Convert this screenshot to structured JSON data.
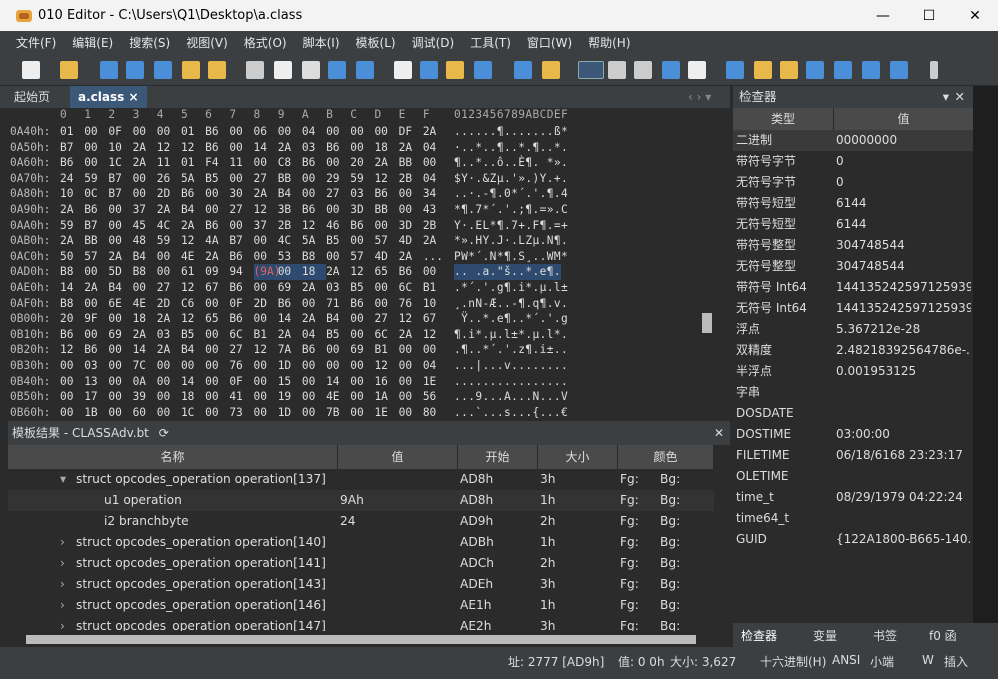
{
  "window": {
    "title": "010 Editor - C:\\Users\\Q1\\Desktop\\a.class",
    "min": "—",
    "max": "☐",
    "close": "✕"
  },
  "menu": [
    "文件(F)",
    "编辑(E)",
    "搜索(S)",
    "视图(V)",
    "格式(O)",
    "脚本(I)",
    "模板(L)",
    "调试(D)",
    "工具(T)",
    "窗口(W)",
    "帮助(H)"
  ],
  "tabs": {
    "start": "起始页",
    "file": "a.class ×"
  },
  "hex": {
    "header_cols": [
      "0",
      "1",
      "2",
      "3",
      "4",
      "5",
      "6",
      "7",
      "8",
      "9",
      "A",
      "B",
      "C",
      "D",
      "E",
      "F"
    ],
    "ascii_header": "0123456789ABCDEF",
    "rows": [
      {
        "addr": "0A40h:",
        "bytes": [
          "01",
          "00",
          "0F",
          "00",
          "00",
          "01",
          "B6",
          "00",
          "06",
          "00",
          "04",
          "00",
          "00",
          "00",
          "DF",
          "2A"
        ],
        "ascii": "......¶.......ß*"
      },
      {
        "addr": "0A50h:",
        "bytes": [
          "B7",
          "00",
          "10",
          "2A",
          "12",
          "12",
          "B6",
          "00",
          "14",
          "2A",
          "03",
          "B6",
          "00",
          "18",
          "2A",
          "04"
        ],
        "ascii": "·..*..¶..*.¶..*."
      },
      {
        "addr": "0A60h:",
        "bytes": [
          "B6",
          "00",
          "1C",
          "2A",
          "11",
          "01",
          "F4",
          "11",
          "00",
          "C8",
          "B6",
          "00",
          "20",
          "2A",
          "BB",
          "00"
        ],
        "ascii": "¶..*..ô..È¶. *»."
      },
      {
        "addr": "0A70h:",
        "bytes": [
          "24",
          "59",
          "B7",
          "00",
          "26",
          "5A",
          "B5",
          "00",
          "27",
          "BB",
          "00",
          "29",
          "59",
          "12",
          "2B",
          "04"
        ],
        "ascii": "$Y·.&Zµ.'».)Y.+."
      },
      {
        "addr": "0A80h:",
        "bytes": [
          "10",
          "0C",
          "B7",
          "00",
          "2D",
          "B6",
          "00",
          "30",
          "2A",
          "B4",
          "00",
          "27",
          "03",
          "B6",
          "00",
          "34"
        ],
        "ascii": "..·.-¶.0*´.'.¶.4"
      },
      {
        "addr": "0A90h:",
        "bytes": [
          "2A",
          "B6",
          "00",
          "37",
          "2A",
          "B4",
          "00",
          "27",
          "12",
          "3B",
          "B6",
          "00",
          "3D",
          "BB",
          "00",
          "43"
        ],
        "ascii": "*¶.7*´.'.;¶.=».C"
      },
      {
        "addr": "0AA0h:",
        "bytes": [
          "59",
          "B7",
          "00",
          "45",
          "4C",
          "2A",
          "B6",
          "00",
          "37",
          "2B",
          "12",
          "46",
          "B6",
          "00",
          "3D",
          "2B"
        ],
        "ascii": "Y·.EL*¶.7+.F¶.=+"
      },
      {
        "addr": "0AB0h:",
        "bytes": [
          "2A",
          "BB",
          "00",
          "48",
          "59",
          "12",
          "4A",
          "B7",
          "00",
          "4C",
          "5A",
          "B5",
          "00",
          "57",
          "4D",
          "2A"
        ],
        "ascii": "*».HY.J·.LZµ.N¶."
      },
      {
        "addr": "0AC0h:",
        "bytes": [
          "50",
          "57",
          "2A",
          "B4",
          "00",
          "4E",
          "2A",
          "B6",
          "00",
          "53",
          "B8",
          "00",
          "57",
          "4D",
          "2A",
          "..."
        ],
        "ascii": "PW*´.N*¶.S¸..WM*"
      },
      {
        "addr": "0AD0h:",
        "bytes": [
          "B8",
          "00",
          "5D",
          "B8",
          "00",
          "61",
          "09",
          "94",
          "(9A)",
          "00",
          "18",
          "2A",
          "12",
          "65",
          "B6",
          "00"
        ],
        "ascii": ".. .a.\"š..*.e¶."
      },
      {
        "addr": "0AE0h:",
        "bytes": [
          "14",
          "2A",
          "B4",
          "00",
          "27",
          "12",
          "67",
          "B6",
          "00",
          "69",
          "2A",
          "03",
          "B5",
          "00",
          "6C",
          "B1"
        ],
        "ascii": ".*´.'.g¶.i*.µ.l±"
      },
      {
        "addr": "0AF0h:",
        "bytes": [
          "B8",
          "00",
          "6E",
          "4E",
          "2D",
          "C6",
          "00",
          "0F",
          "2D",
          "B6",
          "00",
          "71",
          "B6",
          "00",
          "76",
          "10"
        ],
        "ascii": "¸.nN-Æ..-¶.q¶.v."
      },
      {
        "addr": "0B00h:",
        "bytes": [
          "20",
          "9F",
          "00",
          "18",
          "2A",
          "12",
          "65",
          "B6",
          "00",
          "14",
          "2A",
          "B4",
          "00",
          "27",
          "12",
          "67"
        ],
        "ascii": " Ÿ..*.e¶..*´.'.g"
      },
      {
        "addr": "0B10h:",
        "bytes": [
          "B6",
          "00",
          "69",
          "2A",
          "03",
          "B5",
          "00",
          "6C",
          "B1",
          "2A",
          "04",
          "B5",
          "00",
          "6C",
          "2A",
          "12"
        ],
        "ascii": "¶.i*.µ.l±*.µ.l*."
      },
      {
        "addr": "0B20h:",
        "bytes": [
          "12",
          "B6",
          "00",
          "14",
          "2A",
          "B4",
          "00",
          "27",
          "12",
          "7A",
          "B6",
          "00",
          "69",
          "B1",
          "00",
          "00"
        ],
        "ascii": ".¶..*´.'.z¶.i±.."
      },
      {
        "addr": "0B30h:",
        "bytes": [
          "00",
          "03",
          "00",
          "7C",
          "00",
          "00",
          "00",
          "76",
          "00",
          "1D",
          "00",
          "00",
          "00",
          "12",
          "00",
          "04"
        ],
        "ascii": "...|...v........"
      },
      {
        "addr": "0B40h:",
        "bytes": [
          "00",
          "13",
          "00",
          "0A",
          "00",
          "14",
          "00",
          "0F",
          "00",
          "15",
          "00",
          "14",
          "00",
          "16",
          "00",
          "1E"
        ],
        "ascii": "................"
      },
      {
        "addr": "0B50h:",
        "bytes": [
          "00",
          "17",
          "00",
          "39",
          "00",
          "18",
          "00",
          "41",
          "00",
          "19",
          "00",
          "4E",
          "00",
          "1A",
          "00",
          "56"
        ],
        "ascii": "...9...A...N...V"
      },
      {
        "addr": "0B60h:",
        "bytes": [
          "00",
          "1B",
          "00",
          "60",
          "00",
          "1C",
          "00",
          "73",
          "00",
          "1D",
          "00",
          "7B",
          "00",
          "1E",
          "00",
          "80"
        ],
        "ascii": "...`...s...{...€"
      },
      {
        "addr": "0B70h:",
        "bytes": [
          "00",
          "1F",
          "00",
          "84",
          "00",
          "20",
          "00",
          "8C",
          "00",
          "22",
          "00",
          "92",
          "00",
          "23",
          "00",
          "9B"
        ],
        "ascii": "...„. .Œ.\".'.#.›"
      }
    ]
  },
  "template": {
    "title": "模板结果 - CLASSAdv.bt",
    "columns": [
      "名称",
      "值",
      "开始",
      "大小",
      "颜色"
    ],
    "rows": [
      {
        "name": "struct opcodes_operation operation[137]",
        "value": "",
        "start": "AD8h",
        "size": "3h",
        "fg": "Fg:",
        "bg": "Bg:",
        "indent": 1,
        "expand": "▾"
      },
      {
        "name": "u1 operation",
        "value": "9Ah",
        "start": "AD8h",
        "size": "1h",
        "fg": "Fg:",
        "bg": "Bg:",
        "indent": 2,
        "expand": ""
      },
      {
        "name": "i2 branchbyte",
        "value": "24",
        "start": "AD9h",
        "size": "2h",
        "fg": "Fg:",
        "bg": "Bg:",
        "indent": 2,
        "expand": ""
      },
      {
        "name": "struct opcodes_operation operation[140]",
        "value": "",
        "start": "ADBh",
        "size": "1h",
        "fg": "Fg:",
        "bg": "Bg:",
        "indent": 1,
        "expand": "›"
      },
      {
        "name": "struct opcodes_operation operation[141]",
        "value": "",
        "start": "ADCh",
        "size": "2h",
        "fg": "Fg:",
        "bg": "Bg:",
        "indent": 1,
        "expand": "›"
      },
      {
        "name": "struct opcodes_operation operation[143]",
        "value": "",
        "start": "ADEh",
        "size": "3h",
        "fg": "Fg:",
        "bg": "Bg:",
        "indent": 1,
        "expand": "›"
      },
      {
        "name": "struct opcodes_operation operation[146]",
        "value": "",
        "start": "AE1h",
        "size": "1h",
        "fg": "Fg:",
        "bg": "Bg:",
        "indent": 1,
        "expand": "›"
      },
      {
        "name": "struct opcodes_operation operation[147]",
        "value": "",
        "start": "AE2h",
        "size": "3h",
        "fg": "Fg:",
        "bg": "Bg:",
        "indent": 1,
        "expand": "›"
      }
    ]
  },
  "inspector": {
    "title": "检查器",
    "columns": [
      "类型",
      "值"
    ],
    "rows": [
      {
        "k": "二进制",
        "v": "00000000"
      },
      {
        "k": "带符号字节",
        "v": "0"
      },
      {
        "k": "无符号字节",
        "v": "0"
      },
      {
        "k": "带符号短型",
        "v": "6144"
      },
      {
        "k": "无符号短型",
        "v": "6144"
      },
      {
        "k": "带符号整型",
        "v": "304748544"
      },
      {
        "k": "无符号整型",
        "v": "304748544"
      },
      {
        "k": "带符号 Int64",
        "v": "1441352425971259392"
      },
      {
        "k": "无符号 Int64",
        "v": "1441352425971259392"
      },
      {
        "k": "浮点",
        "v": "5.367212e-28"
      },
      {
        "k": "双精度",
        "v": "2.48218392564786e-..."
      },
      {
        "k": "半浮点",
        "v": "0.001953125"
      },
      {
        "k": "字串",
        "v": ""
      },
      {
        "k": "DOSDATE",
        "v": ""
      },
      {
        "k": "DOSTIME",
        "v": "03:00:00"
      },
      {
        "k": "FILETIME",
        "v": "06/18/6168 23:23:17"
      },
      {
        "k": "OLETIME",
        "v": ""
      },
      {
        "k": "time_t",
        "v": "08/29/1979 04:22:24"
      },
      {
        "k": "time64_t",
        "v": ""
      },
      {
        "k": "GUID",
        "v": "{122A1800-B665-140..."
      }
    ],
    "bottom_tabs": [
      "检查器",
      "变量",
      "书签",
      "f0 函"
    ]
  },
  "status": {
    "addr": "址: 2777 [AD9h]",
    "value": "值: 0 0h",
    "size": "大小: 3,627",
    "mode": "十六进制(H)",
    "enc": "ANSI",
    "endian": "小端",
    "w": "W",
    "insert": "插入"
  },
  "colors": {
    "selection": "#2e4a6e",
    "accent": "#3c5878",
    "highlight_byte": "#e06060"
  }
}
